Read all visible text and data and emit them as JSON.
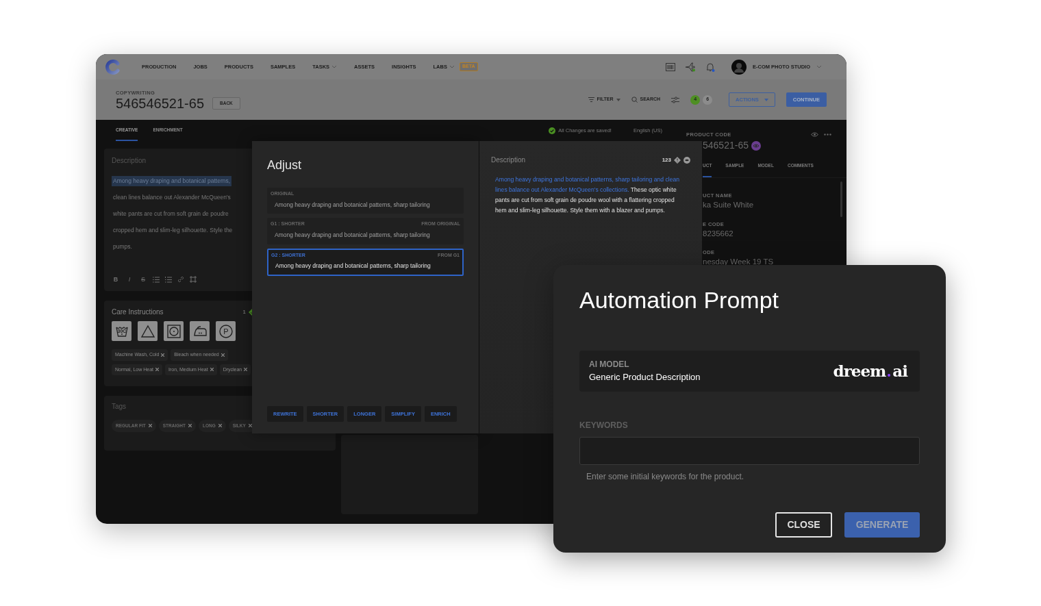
{
  "app": {
    "nav": {
      "items": [
        {
          "label": "PRODUCTION",
          "dropdown": false
        },
        {
          "label": "JOBS",
          "dropdown": false
        },
        {
          "label": "PRODUCTS",
          "dropdown": false
        },
        {
          "label": "SAMPLES",
          "dropdown": false
        },
        {
          "label": "TASKS",
          "dropdown": true
        },
        {
          "label": "ASSETS",
          "dropdown": false
        },
        {
          "label": "INSIGHTS",
          "dropdown": false
        },
        {
          "label": "LABS",
          "dropdown": true,
          "badge": "BETA"
        }
      ],
      "account": "E-COM PHOTO STUDIO"
    },
    "header": {
      "section": "COPYWRITING",
      "title": "546546521-65",
      "back": "BACK",
      "filter": "FILTER",
      "search": "SEARCH",
      "counts": [
        {
          "value": "4",
          "color": "#4e8f23"
        },
        {
          "value": "6",
          "color": "#8c8c8c"
        }
      ],
      "actions": "ACTIONS",
      "continue": "CONTINUE"
    },
    "tabs": [
      {
        "label": "CREATIVE",
        "selected": true
      },
      {
        "label": "ENRICHMENT",
        "selected": false
      }
    ],
    "save_status": "All Changes are saved!",
    "language": "English (US)",
    "description_card": {
      "title": "Description",
      "lines": [
        {
          "text": "Among heavy draping and botanical patterns,",
          "highlighted": true
        },
        {
          "text": "clean lines balance out Alexander McQueen's",
          "highlighted": false
        },
        {
          "text": "white pants are cut from soft grain de poudre",
          "highlighted": false
        },
        {
          "text": "cropped hem and slim-leg silhouette. Style the",
          "highlighted": false
        },
        {
          "text": "pumps.",
          "highlighted": false
        }
      ],
      "toolbar": [
        {
          "kind": "bold",
          "label": "B"
        },
        {
          "kind": "italic",
          "label": "I"
        },
        {
          "kind": "strike",
          "label": "S"
        },
        {
          "kind": "bullets"
        },
        {
          "kind": "numbers"
        },
        {
          "kind": "link"
        },
        {
          "kind": "media"
        }
      ]
    },
    "care_card": {
      "title": "Care Instructions",
      "count": "1",
      "symbols": [
        {
          "kind": "wash",
          "label": "30C"
        },
        {
          "kind": "bleach"
        },
        {
          "kind": "dry"
        },
        {
          "kind": "iron"
        },
        {
          "kind": "dryclean",
          "label": "P"
        }
      ],
      "chips": [
        "Machine Wash, Cold",
        "Bleach when needed",
        "Normal, Low Heat",
        "Iron, Medium Heat",
        "Dryclean"
      ]
    },
    "tags_card": {
      "title": "Tags",
      "tags": [
        "REGULAR FIT",
        "STRAIGHT",
        "LONG",
        "SILKY"
      ]
    },
    "product_panel": {
      "code_label": "PRODUCT CODE",
      "code": "546521-65",
      "tabs": [
        {
          "label": "UCT",
          "selected": true
        },
        {
          "label": "SAMPLE",
          "selected": false
        },
        {
          "label": "MODEL",
          "selected": false
        },
        {
          "label": "COMMENTS",
          "selected": false
        }
      ],
      "fields": [
        {
          "label": "UCT NAME",
          "value": "ka Suite White"
        },
        {
          "label": "E CODE",
          "value": "8235662"
        },
        {
          "label": "ODE",
          "value": "nesday Week 19 TS"
        }
      ]
    }
  },
  "adjust": {
    "title": "Adjust",
    "options": [
      {
        "label": "ORIGINAL",
        "text": "Among heavy draping and botanical patterns, sharp tailoring",
        "selected": false
      },
      {
        "label": "G1 : SHORTER",
        "source": "FROM ORIGINAL",
        "text": "Among heavy draping and botanical patterns, sharp tailoring",
        "selected": false
      },
      {
        "label": "G2 : SHORTER",
        "source": "FROM G1",
        "text": "Among heavy draping and botanical patterns, sharp tailoring",
        "selected": true
      }
    ],
    "actions": [
      "REWRITE",
      "SHORTER",
      "LONGER",
      "SIMPLIFY",
      "ENRICH"
    ]
  },
  "preview": {
    "title": "Description",
    "count": "123",
    "highlighted": "Among heavy draping and botanical patterns, sharp tailoring and clean lines balance out Alexander McQueen's collections.",
    "text": "These optic white pants are cut from soft grain de poudre wool with a flattering cropped hem and slim-leg silhouette. Style them with a blazer and pumps."
  },
  "automation": {
    "title": "Automation Prompt",
    "model_label": "AI MODEL",
    "model": "Generic Product Description",
    "logo": {
      "name": "dreem",
      "suffix": "ai"
    },
    "keywords_label": "KEYWORDS",
    "keywords_help": "Enter some initial keywords for the product.",
    "buttons": [
      {
        "label": "CLOSE",
        "kind": "secondary",
        "disabled": false
      },
      {
        "label": "GENERATE",
        "kind": "primary",
        "disabled": true
      }
    ]
  }
}
